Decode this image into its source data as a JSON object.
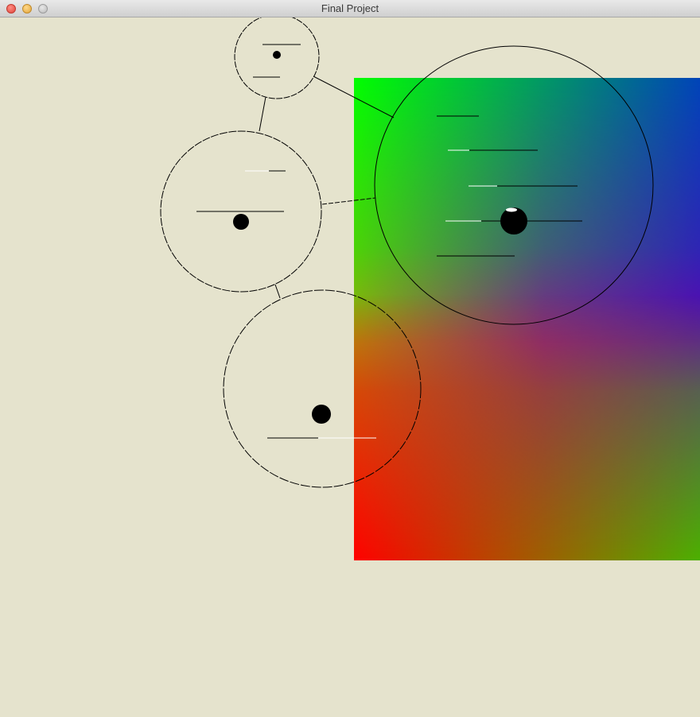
{
  "window": {
    "title": "Final Project",
    "background": "#e5e3cd"
  },
  "gradient_panel": {
    "corners": {
      "top_left": "#00ff00",
      "top_right": "#0044b8",
      "mid_right": "#6600b0",
      "bottom_left": "#ff0000",
      "bottom_right": "#4cb000"
    }
  },
  "nodes": [
    {
      "id": "node-top"
    },
    {
      "id": "node-left"
    },
    {
      "id": "node-large"
    },
    {
      "id": "node-bottom"
    }
  ],
  "edges": [
    {
      "from": "node-top",
      "to": "node-left"
    },
    {
      "from": "node-top",
      "to": "node-large"
    },
    {
      "from": "node-left",
      "to": "node-large"
    },
    {
      "from": "node-left",
      "to": "node-bottom"
    }
  ]
}
